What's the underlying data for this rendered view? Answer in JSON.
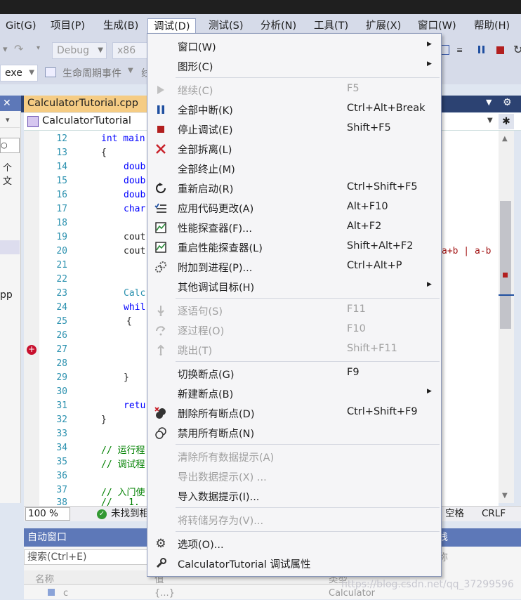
{
  "menubar": {
    "items": [
      {
        "label": "Git(G)"
      },
      {
        "label": "项目(P)"
      },
      {
        "label": "生成(B)"
      },
      {
        "label": "调试(D)"
      },
      {
        "label": "测试(S)"
      },
      {
        "label": "分析(N)"
      },
      {
        "label": "工具(T)"
      },
      {
        "label": "扩展(X)"
      },
      {
        "label": "窗口(W)"
      },
      {
        "label": "帮助(H)"
      }
    ]
  },
  "toolbar": {
    "config": "Debug",
    "platform": "x86",
    "target_suffix": "exe",
    "lifecycle_label": "生命周期事件",
    "lifecycle_suffix": "线"
  },
  "left_panel": {
    "close_glyph": "✕",
    "search_fragment": "个文",
    "file_fragment": "pp"
  },
  "editor": {
    "tab_label": "CalculatorTutorial.cpp",
    "scope_label": "CalculatorTutorial",
    "pin_glyph": "✱",
    "right_fragment": "a+b | a-b",
    "lines": [
      {
        "n": "12",
        "t": "int main"
      },
      {
        "n": "13",
        "t": "{"
      },
      {
        "n": "14",
        "t": "doub"
      },
      {
        "n": "15",
        "t": "doub"
      },
      {
        "n": "16",
        "t": "doub"
      },
      {
        "n": "17",
        "t": "char"
      },
      {
        "n": "18",
        "t": ""
      },
      {
        "n": "19",
        "t": "cout"
      },
      {
        "n": "20",
        "t": "cout"
      },
      {
        "n": "21",
        "t": ""
      },
      {
        "n": "22",
        "t": ""
      },
      {
        "n": "23",
        "t": "Calc"
      },
      {
        "n": "24",
        "t": "whil"
      },
      {
        "n": "25",
        "t": "{"
      },
      {
        "n": "26",
        "t": ""
      },
      {
        "n": "27",
        "t": ""
      },
      {
        "n": "28",
        "t": ""
      },
      {
        "n": "29",
        "t": "}"
      },
      {
        "n": "30",
        "t": ""
      },
      {
        "n": "31",
        "t": "retu"
      },
      {
        "n": "32",
        "t": "}"
      },
      {
        "n": "33",
        "t": ""
      },
      {
        "n": "34",
        "t": "// 运行程"
      },
      {
        "n": "35",
        "t": "// 调试程"
      },
      {
        "n": "36",
        "t": ""
      },
      {
        "n": "37",
        "t": "// 入门使"
      },
      {
        "n": "38",
        "t": "//   1."
      }
    ]
  },
  "status": {
    "zoom": "100 %",
    "issues": "未找到相",
    "whitespace": "空格",
    "eol": "CRLF"
  },
  "bottom": {
    "autos_title": "自动窗口",
    "search_placeholder": "搜索(Ctrl+E)",
    "col_name": "名称",
    "col_value": "值",
    "col_type": "类型",
    "row_name": "c",
    "row_value": "{...}",
    "row_type": "Calculator",
    "right_title_fragment": "栈",
    "right_sub_fragment": "称",
    "watermark": "https://blog.csdn.net/qq_37299596"
  },
  "debug_menu": {
    "items": [
      {
        "label": "窗口(W)",
        "shortcut": "",
        "submenu": true,
        "disabled": false,
        "icon": ""
      },
      {
        "label": "图形(C)",
        "shortcut": "",
        "submenu": true,
        "disabled": false,
        "icon": ""
      },
      {
        "label": "继续(C)",
        "shortcut": "F5",
        "submenu": false,
        "disabled": true,
        "icon": "play-icon"
      },
      {
        "label": "全部中断(K)",
        "shortcut": "Ctrl+Alt+Break",
        "submenu": false,
        "disabled": false,
        "icon": "pause-icon"
      },
      {
        "label": "停止调试(E)",
        "shortcut": "Shift+F5",
        "submenu": false,
        "disabled": false,
        "icon": "stop-icon"
      },
      {
        "label": "全部拆离(L)",
        "shortcut": "",
        "submenu": false,
        "disabled": false,
        "icon": "detach-x-icon"
      },
      {
        "label": "全部终止(M)",
        "shortcut": "",
        "submenu": false,
        "disabled": false,
        "icon": ""
      },
      {
        "label": "重新启动(R)",
        "shortcut": "Ctrl+Shift+F5",
        "submenu": false,
        "disabled": false,
        "icon": "restart-icon"
      },
      {
        "label": "应用代码更改(A)",
        "shortcut": "Alt+F10",
        "submenu": false,
        "disabled": false,
        "icon": "apply-changes-icon"
      },
      {
        "label": "性能探查器(F)...",
        "shortcut": "Alt+F2",
        "submenu": false,
        "disabled": false,
        "icon": "profiler-icon"
      },
      {
        "label": "重启性能探查器(L)",
        "shortcut": "Shift+Alt+F2",
        "submenu": false,
        "disabled": false,
        "icon": "profiler-restart-icon"
      },
      {
        "label": "附加到进程(P)...",
        "shortcut": "Ctrl+Alt+P",
        "submenu": false,
        "disabled": false,
        "icon": "attach-gears-icon"
      },
      {
        "label": "其他调试目标(H)",
        "shortcut": "",
        "submenu": true,
        "disabled": false,
        "icon": ""
      },
      {
        "label": "逐语句(S)",
        "shortcut": "F11",
        "submenu": false,
        "disabled": true,
        "icon": "step-into-icon"
      },
      {
        "label": "逐过程(O)",
        "shortcut": "F10",
        "submenu": false,
        "disabled": true,
        "icon": "step-over-icon"
      },
      {
        "label": "跳出(T)",
        "shortcut": "Shift+F11",
        "submenu": false,
        "disabled": true,
        "icon": "step-out-icon"
      },
      {
        "label": "切换断点(G)",
        "shortcut": "F9",
        "submenu": false,
        "disabled": false,
        "icon": ""
      },
      {
        "label": "新建断点(B)",
        "shortcut": "",
        "submenu": true,
        "disabled": false,
        "icon": ""
      },
      {
        "label": "删除所有断点(D)",
        "shortcut": "Ctrl+Shift+F9",
        "submenu": false,
        "disabled": false,
        "icon": "delete-breakpoints-icon"
      },
      {
        "label": "禁用所有断点(N)",
        "shortcut": "",
        "submenu": false,
        "disabled": false,
        "icon": "disable-breakpoints-icon"
      },
      {
        "label": "清除所有数据提示(A)",
        "shortcut": "",
        "submenu": false,
        "disabled": true,
        "icon": ""
      },
      {
        "label": "导出数据提示(X) ...",
        "shortcut": "",
        "submenu": false,
        "disabled": true,
        "icon": ""
      },
      {
        "label": "导入数据提示(I)...",
        "shortcut": "",
        "submenu": false,
        "disabled": false,
        "icon": ""
      },
      {
        "label": "将转储另存为(V)...",
        "shortcut": "",
        "submenu": false,
        "disabled": true,
        "icon": ""
      },
      {
        "label": "选项(O)...",
        "shortcut": "",
        "submenu": false,
        "disabled": false,
        "icon": "gear-icon"
      },
      {
        "label": "CalculatorTutorial 调试属性",
        "shortcut": "",
        "submenu": false,
        "disabled": false,
        "icon": "wrench-icon"
      }
    ]
  }
}
